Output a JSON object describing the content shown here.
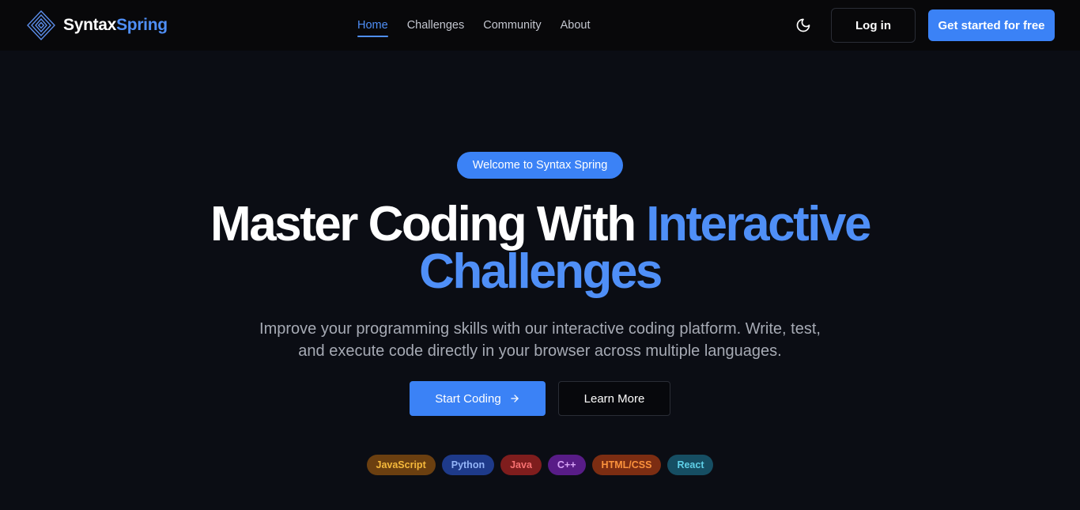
{
  "brand": {
    "part1": "Syntax",
    "part2": "Spring"
  },
  "nav": {
    "links": [
      {
        "label": "Home",
        "active": true
      },
      {
        "label": "Challenges",
        "active": false
      },
      {
        "label": "Community",
        "active": false
      },
      {
        "label": "About",
        "active": false
      }
    ],
    "theme_icon": "moon-icon",
    "login_label": "Log in",
    "cta_label": "Get started for free"
  },
  "hero": {
    "badge": "Welcome to Syntax Spring",
    "headline_plain": "Master Coding With ",
    "headline_accent_1": "Interactive",
    "headline_accent_2": "Challenges",
    "subtitle_line1": "Improve your programming skills with our interactive coding platform. Write, test,",
    "subtitle_line2": "and execute code directly in your browser across multiple languages.",
    "primary_button": "Start Coding",
    "primary_icon": "arrow-right-icon",
    "secondary_button": "Learn More",
    "tags": [
      "JavaScript",
      "Python",
      "Java",
      "C++",
      "HTML/CSS",
      "React"
    ]
  },
  "colors": {
    "accent": "#3b82f6",
    "accent_text": "#4f8ff7",
    "background": "#0b0d14",
    "navbar": "#08080a"
  }
}
